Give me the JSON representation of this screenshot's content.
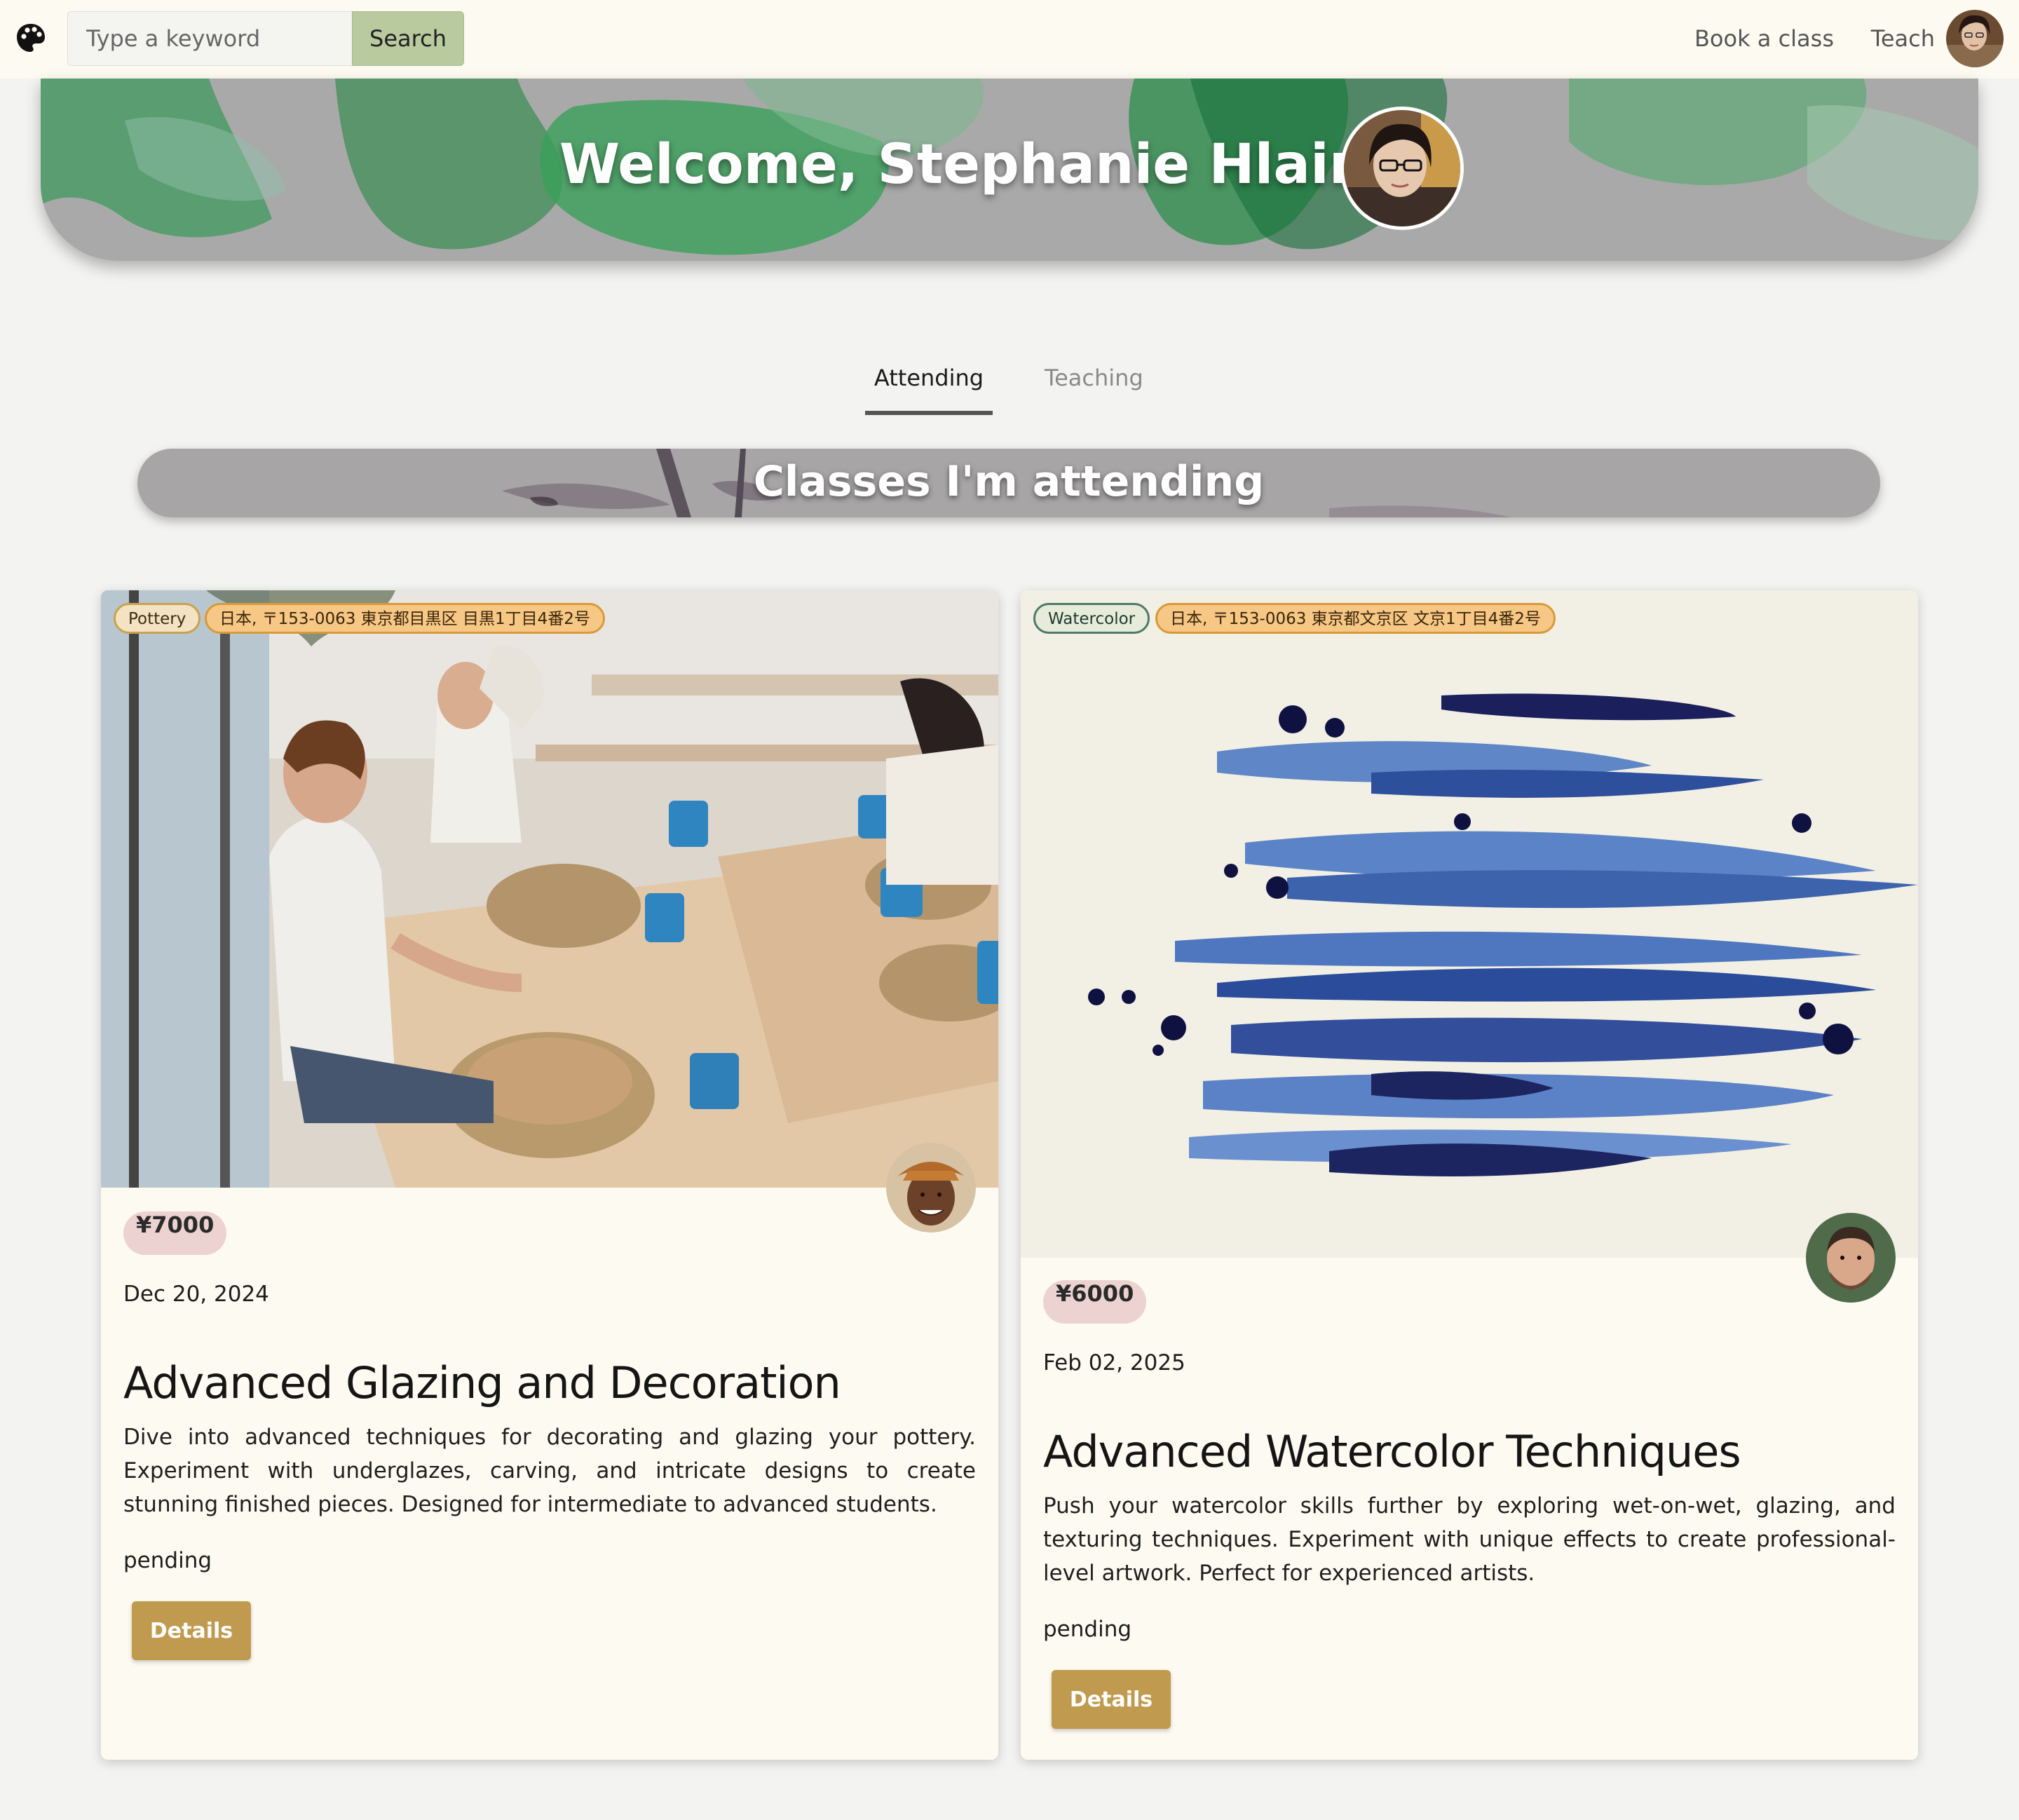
{
  "navbar": {
    "search_placeholder": "Type a keyword",
    "search_button": "Search",
    "links": {
      "book": "Book a class",
      "teach": "Teach"
    }
  },
  "banner": {
    "title": "Welcome, Stephanie Hlaing!"
  },
  "tabs": [
    {
      "label": "Attending",
      "active": true
    },
    {
      "label": "Teaching",
      "active": false
    }
  ],
  "section": {
    "title": "Classes I'm attending"
  },
  "classes": [
    {
      "category": "Pottery",
      "address": "日本, 〒153-0063 東京都目黒区 目黒1丁目4番2号",
      "price": "¥7000",
      "date": "Dec 20, 2024",
      "title": "Advanced Glazing and Decoration",
      "description": "Dive into advanced techniques for decorating and glazing your pottery. Experiment with underglazes, carving, and intricate designs to create stunning finished pieces. Designed for intermediate to advanced students.",
      "status": "pending",
      "button": "Details"
    },
    {
      "category": "Watercolor",
      "address": "日本, 〒153-0063 東京都文京区 文京1丁目4番2号",
      "price": "¥6000",
      "date": "Feb 02, 2025",
      "title": "Advanced Watercolor Techniques",
      "description": "Push your watercolor skills further by exploring wet-on-wet, glazing, and texturing techniques. Experiment with unique effects to create professional-level artwork. Perfect for experienced artists.",
      "status": "pending",
      "button": "Details"
    }
  ],
  "colors": {
    "navbar_bg": "#fdfbf1",
    "search_button": "#b9ca9f",
    "card_bg": "#fdfbf1",
    "details_button": "#c09a4e",
    "price_badge": "#ecd2d0",
    "address_tag": "#f6c785"
  },
  "icons": {
    "logo": "palette-icon"
  }
}
